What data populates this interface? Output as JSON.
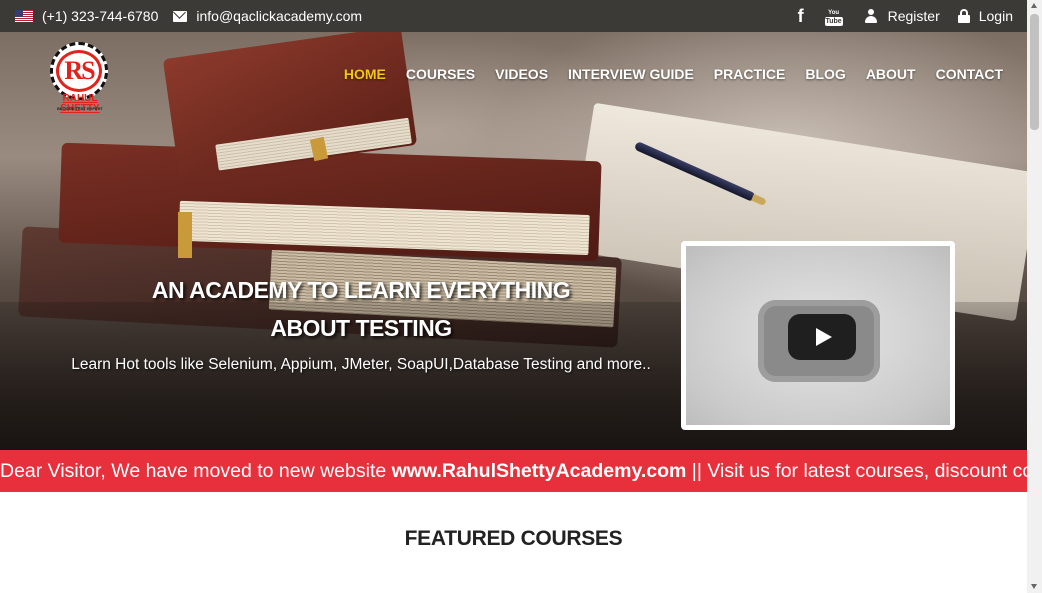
{
  "topbar": {
    "phone": "(+1) 323-744-6780",
    "email": "info@qaclickacademy.com",
    "register": "Register",
    "login": "Login",
    "icons": [
      "us-flag-icon",
      "mail-icon",
      "facebook-icon",
      "youtube-icon",
      "user-icon",
      "lock-icon"
    ]
  },
  "logo": {
    "monogram": "RS",
    "name": "RAHUL SHETTY",
    "tagline": "BECOME TEST EXPERT"
  },
  "nav": {
    "items": [
      "HOME",
      "COURSES",
      "VIDEOS",
      "INTERVIEW GUIDE",
      "PRACTICE",
      "BLOG",
      "ABOUT",
      "CONTACT"
    ],
    "active": "HOME",
    "active_color": "#f3c617"
  },
  "hero": {
    "title": "AN ACADEMY TO LEARN EVERYTHING ABOUT TESTING",
    "subtitle": "Learn Hot tools like Selenium, Appium, JMeter, SoapUI,Database Testing and more.."
  },
  "announcement": {
    "prefix": "Dear Visitor, We have moved to new website ",
    "link": "www.RahulShettyAcademy.com",
    "suffix": " || Visit us for latest courses, discount co",
    "background": "#e8303c"
  },
  "featured": {
    "heading": "FEATURED COURSES"
  }
}
